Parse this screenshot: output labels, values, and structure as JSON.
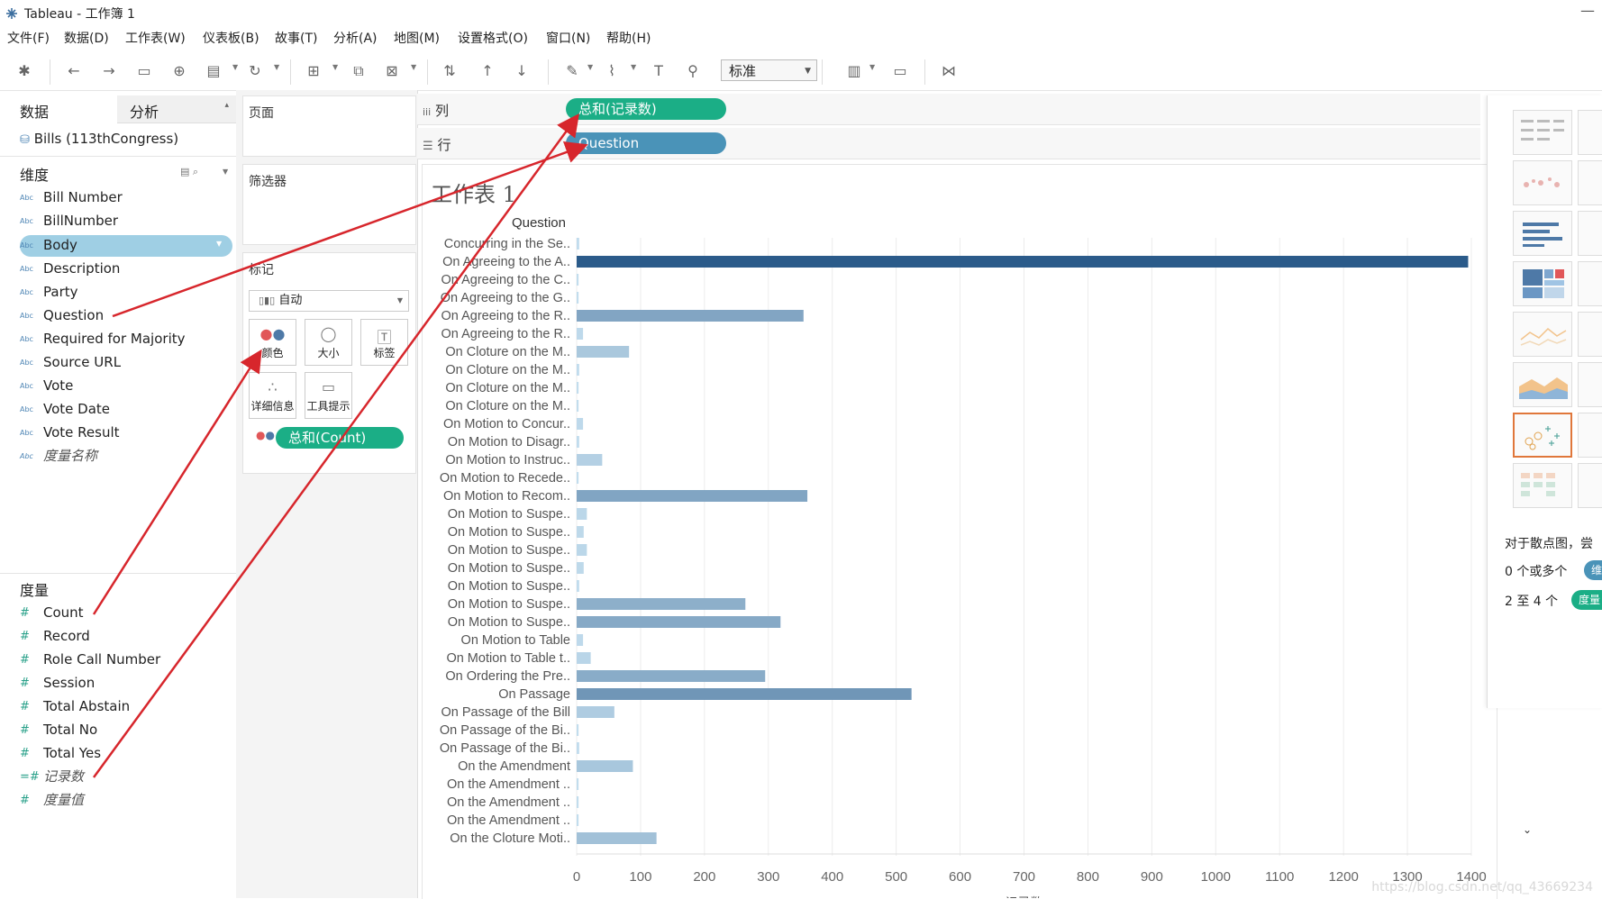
{
  "window": {
    "title": "Tableau - 工作簿 1"
  },
  "menu": [
    "文件(F)",
    "数据(D)",
    "工作表(W)",
    "仪表板(B)",
    "故事(T)",
    "分析(A)",
    "地图(M)",
    "设置格式(O)",
    "窗口(N)",
    "帮助(H)"
  ],
  "toolbar": {
    "fit_select": "标准"
  },
  "data_pane": {
    "tab_data": "数据",
    "tab_analysis": "分析",
    "datasource": "Bills (113thCongress)",
    "dimensions_header": "维度",
    "dimensions": [
      "Bill Number",
      "BillNumber",
      "Body",
      "Description",
      "Party",
      "Question",
      "Required for Majority",
      "Source URL",
      "Vote",
      "Vote Date",
      "Vote Result",
      "度量名称"
    ],
    "measures_header": "度量",
    "measures": [
      "Count",
      "Record",
      "Role Call Number",
      "Session",
      "Total Abstain",
      "Total No",
      "Total Yes",
      "记录数",
      "度量值"
    ],
    "type_abc": "Abc"
  },
  "shelves": {
    "pages": "页面",
    "filters": "筛选器",
    "marks": "标记",
    "mark_type": "自动",
    "mark_buttons": [
      "颜色",
      "大小",
      "标签",
      "详细信息",
      "工具提示"
    ],
    "color_pill": "总和(Count)",
    "columns_label": "列",
    "rows_label": "行",
    "columns_pill": "总和(记录数)",
    "rows_pill": "Question"
  },
  "sheet": {
    "title": "工作表 1"
  },
  "chart_data": {
    "type": "bar",
    "orientation": "horizontal",
    "ylabel": "Question",
    "xlabel": "记录数",
    "xlim": [
      0,
      1400
    ],
    "xticks": [
      0,
      100,
      200,
      300,
      400,
      500,
      600,
      700,
      800,
      900,
      1000,
      1100,
      1200,
      1300,
      1400
    ],
    "categories": [
      "Concurring in the Se..",
      "On Agreeing to the A..",
      "On Agreeing to the C..",
      "On Agreeing to the G..",
      "On Agreeing to the R..",
      "On Agreeing to the R..",
      "On Cloture on the M..",
      "On Cloture on the M..",
      "On Cloture on the M..",
      "On Cloture on the M..",
      "On Motion to Concur..",
      "On Motion to Disagr..",
      "On Motion to Instruc..",
      "On Motion to Recede..",
      "On Motion to Recom..",
      "On Motion to Suspe..",
      "On Motion to Suspe..",
      "On Motion to Suspe..",
      "On Motion to Suspe..",
      "On Motion to Suspe..",
      "On Motion to Suspe..",
      "On Motion to Suspe..",
      "On Motion to Table",
      "On Motion to Table t..",
      "On Ordering the Pre..",
      "On Passage",
      "On Passage of the Bill",
      "On Passage of the Bi..",
      "On Passage of the Bi..",
      "On the Amendment",
      "On the Amendment ..",
      "On the Amendment ..",
      "On the Amendment ..",
      "On the Cloture Moti.."
    ],
    "values": [
      4,
      1395,
      3,
      3,
      355,
      10,
      82,
      4,
      3,
      3,
      10,
      4,
      40,
      3,
      361,
      16,
      11,
      16,
      11,
      4,
      264,
      319,
      10,
      22,
      295,
      524,
      59,
      3,
      4,
      88,
      3,
      3,
      3,
      125
    ],
    "color_scale": {
      "low": "#c6e0f0",
      "high": "#2b5b8a"
    },
    "grid": "vertical"
  },
  "show_me": {
    "hint": "对于散点图，尝",
    "row1": "0 个或多个",
    "row1_pill": "维",
    "row2": "2 至 4 个",
    "row2_pill": "度量"
  },
  "watermark": "https://blog.csdn.net/qq_43669234"
}
